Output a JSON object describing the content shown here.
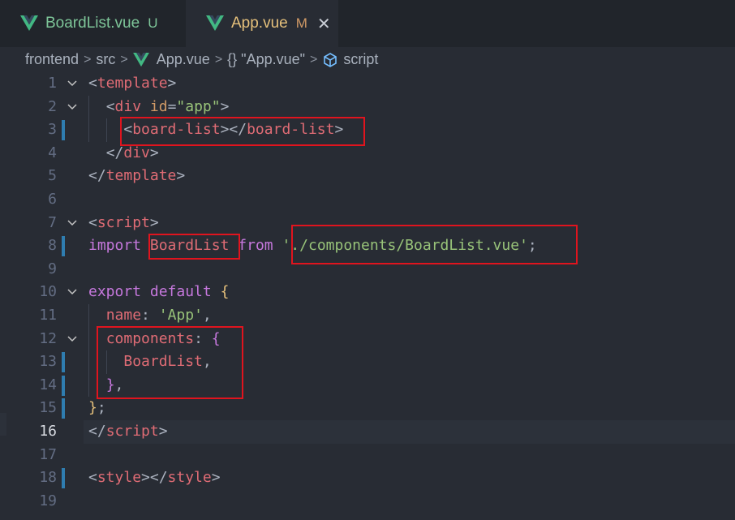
{
  "tabs": [
    {
      "name": "BoardList.vue",
      "status": "U"
    },
    {
      "name": "App.vue",
      "status": "M",
      "close": "✕"
    }
  ],
  "breadcrumb": {
    "items": [
      "frontend",
      "src",
      "App.vue",
      "{} \"App.vue\"",
      "script"
    ],
    "separator": ">"
  },
  "editor": {
    "active_line": "16",
    "lines": [
      {
        "num": "1"
      },
      {
        "num": "2"
      },
      {
        "num": "3"
      },
      {
        "num": "4"
      },
      {
        "num": "5"
      },
      {
        "num": "6"
      },
      {
        "num": "7"
      },
      {
        "num": "8"
      },
      {
        "num": "9"
      },
      {
        "num": "10"
      },
      {
        "num": "11"
      },
      {
        "num": "12"
      },
      {
        "num": "13"
      },
      {
        "num": "14"
      },
      {
        "num": "15"
      },
      {
        "num": "16"
      },
      {
        "num": "17"
      },
      {
        "num": "18"
      },
      {
        "num": "19"
      }
    ],
    "tokens": {
      "template_open": "template",
      "div": "div",
      "id_attr": "id",
      "app_str": "\"app\"",
      "board_list": "board-list",
      "script": "script",
      "import_kw": "import",
      "boardlist": "BoardList",
      "from_kw": "from",
      "path_str": "'./components/BoardList.vue'",
      "export_kw": "export",
      "default_kw": "default",
      "name_prop": "name",
      "app_name_str": "'App'",
      "components_prop": "components",
      "style": "style"
    }
  },
  "colors": {
    "background": "#282c34",
    "tab_bar": "#21252b",
    "highlight_box": "#e0141e",
    "vue_green": "#42b883"
  }
}
